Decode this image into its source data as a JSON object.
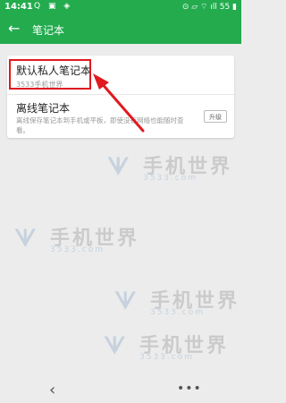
{
  "status_bar": {
    "time": "14:41",
    "left_icons": "Q ▣ ◈",
    "right_icons": "⊙ ▱ ⌔ ıll 55 ▮"
  },
  "app_bar": {
    "back_icon": "←",
    "title": "笔记本"
  },
  "notebooks": [
    {
      "name": "默认私人笔记本",
      "subtitle": "3533手机世界"
    },
    {
      "name": "离线笔记本",
      "description": "离线保存笔记本到手机或平板，即使没有网络也能随时查看。",
      "action_label": "升级"
    }
  ],
  "watermark": {
    "brand": "手机世界",
    "number": "3533.com"
  },
  "nav_bar": {
    "back_icon": "‹",
    "menu_icon": "•••"
  },
  "colors": {
    "accent": "#23ab4e",
    "highlight": "#e0191f"
  }
}
